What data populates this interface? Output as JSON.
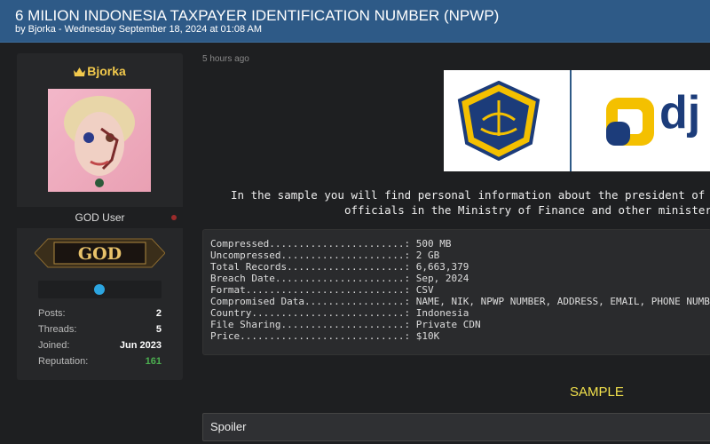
{
  "thread": {
    "title": "6 MILION INDONESIA TAXPAYER IDENTIFICATION NUMBER (NPWP)",
    "byline": "by Bjorka - Wednesday September 18, 2024 at 01:08 AM"
  },
  "user": {
    "name": "Bjorka",
    "role": "GOD User",
    "badge": "GOD",
    "stats": [
      {
        "label": "Posts:",
        "value": "2"
      },
      {
        "label": "Threads:",
        "value": "5"
      },
      {
        "label": "Joined:",
        "value": "Jun 2023"
      },
      {
        "label": "Reputation:",
        "value": "161"
      }
    ]
  },
  "post": {
    "time_ago": "5 hours ago",
    "logo_text": "dj",
    "intro_line1": "In the sample you will find personal information about the president of In",
    "intro_line2": "officials in the Ministry of Finance and other ministers",
    "details": [
      "Compressed.......................: 500 MB",
      "Uncompressed.....................: 2 GB",
      "Total Records....................: 6,663,379",
      "Breach Date......................: Sep, 2024",
      "Format...........................: CSV",
      "Compromised Data.................: NAME, NIK, NPWP NUMBER, ADDRESS, EMAIL, PHONE NUMBER,",
      "Country..........................: Indonesia",
      "File Sharing.....................: Private CDN",
      "Price............................: $10K"
    ],
    "sample_label": "SAMPLE",
    "spoiler_label": "Spoiler"
  },
  "colors": {
    "header": "#2e5a87",
    "username": "#f2c94c",
    "reputation": "#4caf50",
    "sample": "#f2e14c"
  }
}
